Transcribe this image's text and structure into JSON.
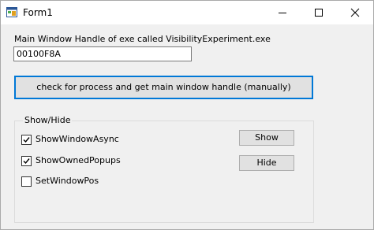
{
  "window": {
    "title": "Form1"
  },
  "main": {
    "handle_label": "Main Window Handle of exe called VisibilityExperiment.exe",
    "handle_value": "00100F8A",
    "check_button_label": "check for process and get main window handle (manually)"
  },
  "group": {
    "title": "Show/Hide",
    "checkboxes": [
      {
        "label": "ShowWindowAsync",
        "checked": true
      },
      {
        "label": "ShowOwnedPopups",
        "checked": true
      },
      {
        "label": "SetWindowPos",
        "checked": false
      }
    ],
    "show_label": "Show",
    "hide_label": "Hide"
  },
  "colors": {
    "accent": "#0078d7",
    "button_face": "#e1e1e1",
    "form_background": "#f0f0f0"
  },
  "icons": [
    "app-icon",
    "minimize-icon",
    "maximize-icon",
    "close-icon",
    "check-icon"
  ]
}
